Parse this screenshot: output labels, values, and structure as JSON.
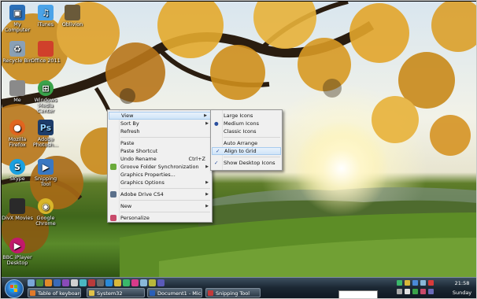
{
  "desktop_icons": [
    {
      "label": "My Computer",
      "color": "#2a6fb8",
      "glyph": "▣"
    },
    {
      "label": "iTunes",
      "color": "#4aa3e8",
      "glyph": "♫"
    },
    {
      "label": "Oblivion",
      "color": "#6a5a3a",
      "glyph": ""
    },
    {
      "label": "Recycle Bin",
      "color": "#8aa0b5",
      "glyph": "♻"
    },
    {
      "label": "Office 2011",
      "color": "#d0402b",
      "glyph": ""
    },
    {
      "label": "Me",
      "color": "#8a8a8a",
      "glyph": ""
    },
    {
      "label": "Windows Media Center",
      "color": "#3aa34a",
      "glyph": "⊞"
    },
    {
      "label": "Mozilla Firefox",
      "color": "#e1651f",
      "glyph": "●"
    },
    {
      "label": "Adobe Photosh...",
      "color": "#1d3d6b",
      "glyph": "Ps"
    },
    {
      "label": "Skype",
      "color": "#1aa0e0",
      "glyph": "S"
    },
    {
      "label": "Snipping Tool",
      "color": "#3a78c2",
      "glyph": "▶"
    },
    {
      "label": "DivX Movies",
      "color": "#2a2a2a",
      "glyph": ""
    },
    {
      "label": "Google Chrome",
      "color": "#d9b62a",
      "glyph": "◉"
    },
    {
      "label": "BBC iPlayer Desktop",
      "color": "#c2186b",
      "glyph": "▶"
    }
  ],
  "context_menu": {
    "items": [
      {
        "label": "View",
        "arrow": "▶",
        "highlighted": true
      },
      {
        "label": "Sort By",
        "arrow": "▶"
      },
      {
        "label": "Refresh"
      },
      {
        "separator": true
      },
      {
        "label": "Paste"
      },
      {
        "label": "Paste Shortcut"
      },
      {
        "label": "Undo Rename",
        "shortcut": "Ctrl+Z"
      },
      {
        "label": "Groove Folder Synchronization",
        "arrow": "▶",
        "icon_color": "#6aaa3a"
      },
      {
        "label": "Graphics Properties..."
      },
      {
        "label": "Graphics Options",
        "arrow": "▶"
      },
      {
        "separator": true
      },
      {
        "label": "Adobe Drive CS4",
        "arrow": "▶",
        "icon_color": "#5a6f8a"
      },
      {
        "separator": true
      },
      {
        "label": "New",
        "arrow": "▶"
      },
      {
        "separator": true
      },
      {
        "label": "Personalize",
        "icon_color": "#c84a6a"
      }
    ]
  },
  "view_submenu": {
    "items": [
      {
        "label": "Large Icons"
      },
      {
        "label": "Medium Icons",
        "mark": "●"
      },
      {
        "label": "Classic Icons"
      },
      {
        "separator": true
      },
      {
        "label": "Auto Arrange"
      },
      {
        "label": "Align to Grid",
        "mark": "✓",
        "highlighted": true
      },
      {
        "separator": true
      },
      {
        "label": "Show Desktop Icons",
        "mark": "✓"
      }
    ]
  },
  "taskbar": {
    "tasks": [
      {
        "label": "Table of keyboard s...",
        "icon_color": "#e07a2a"
      },
      {
        "label": "System32",
        "icon_color": "#e0c24a"
      },
      {
        "label": "Document1 - Micro...",
        "icon_color": "#2a5fb8"
      },
      {
        "label": "Snipping Tool",
        "icon_color": "#c23a3a"
      }
    ],
    "quick_launch_colors": [
      "#7aa7d8",
      "#4a8a3a",
      "#e08a2a",
      "#3a6ab8",
      "#8a4ab8",
      "#d0d0d0",
      "#4ab8c2",
      "#b83a3a",
      "#6a6a6a",
      "#2a8ad8",
      "#d8b83a",
      "#3ab86a",
      "#d83a8a",
      "#8ab8d8",
      "#b8b83a",
      "#5a5ab8"
    ],
    "clock_time": "21:58",
    "clock_day": "Sunday"
  }
}
